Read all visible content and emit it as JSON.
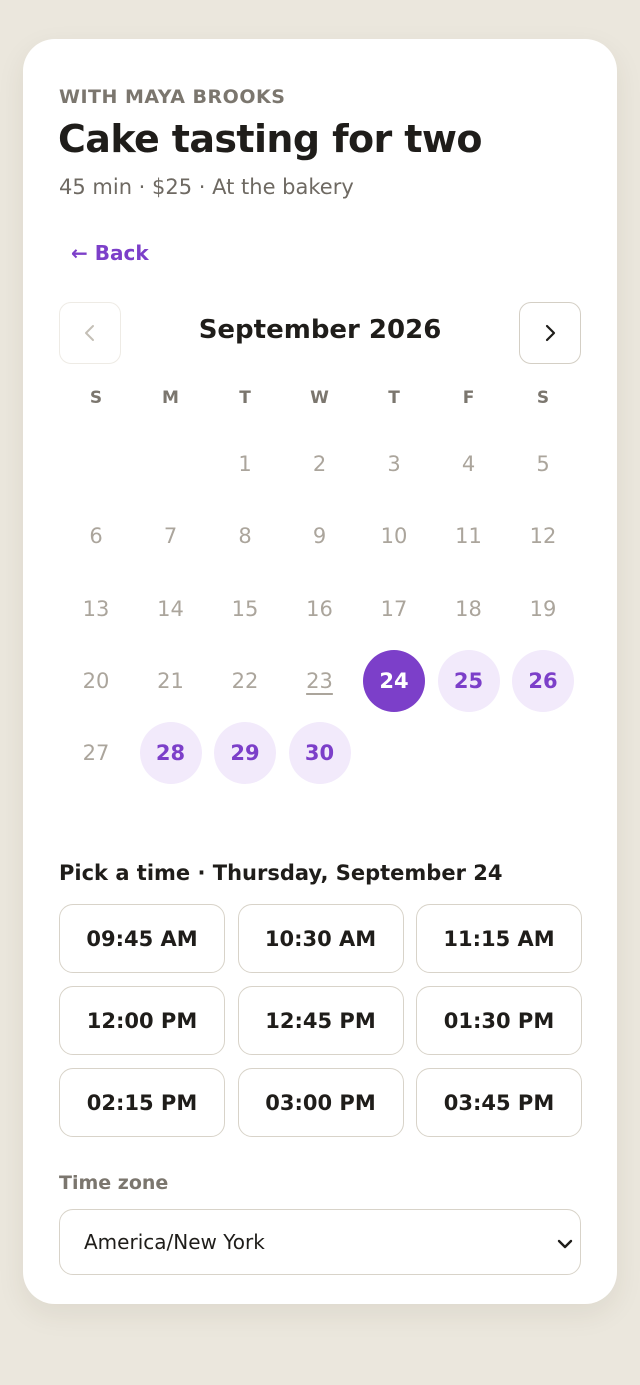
{
  "host": {
    "eyebrow": "WITH MAYA BROOKS"
  },
  "event": {
    "title": "Cake tasting for two",
    "meta": "45 min · $25 · At the bakery"
  },
  "nav": {
    "back_label": "← Back"
  },
  "calendar": {
    "month_label": "September 2026",
    "prev_icon": "chevron-left-icon",
    "next_icon": "chevron-right-icon",
    "weekdays": [
      "S",
      "M",
      "T",
      "W",
      "T",
      "F",
      "S"
    ],
    "first_weekday_index": 2,
    "days_in_month": 30,
    "today": 23,
    "selected": 24,
    "available": [
      25,
      26,
      28,
      29,
      30
    ]
  },
  "times": {
    "heading": "Pick a time · Thursday, September 24",
    "slots": [
      "09:45 AM",
      "10:30 AM",
      "11:15 AM",
      "12:00 PM",
      "12:45 PM",
      "01:30 PM",
      "02:15 PM",
      "03:00 PM",
      "03:45 PM"
    ]
  },
  "timezone": {
    "label": "Time zone",
    "value": "America/New York"
  },
  "colors": {
    "accent": "#7c3fc9",
    "accent_soft": "#f2eafb",
    "background": "#ebe7dd",
    "muted_day": "#aba59c"
  }
}
